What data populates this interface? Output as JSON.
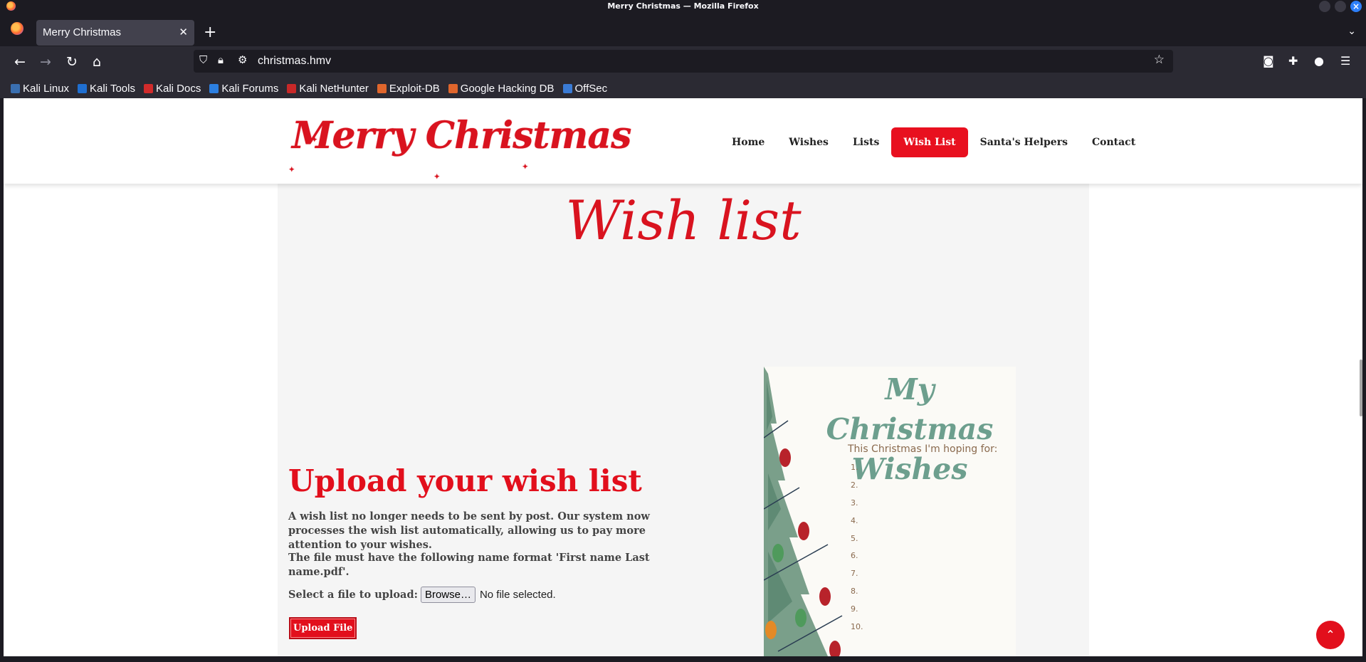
{
  "window": {
    "title": "Merry Christmas — Mozilla Firefox"
  },
  "tab": {
    "title": "Merry Christmas",
    "close": "✕",
    "new": "+"
  },
  "navbar": {
    "url": "christmas.hmv"
  },
  "bookmarks": [
    {
      "label": "Kali Linux",
      "color": "#3a6fb0"
    },
    {
      "label": "Kali Tools",
      "color": "#1f6fd1"
    },
    {
      "label": "Kali Docs",
      "color": "#d12b2b"
    },
    {
      "label": "Kali Forums",
      "color": "#2c7fe0"
    },
    {
      "label": "Kali NetHunter",
      "color": "#c82828"
    },
    {
      "label": "Exploit-DB",
      "color": "#e0662c"
    },
    {
      "label": "Google Hacking DB",
      "color": "#e0662c"
    },
    {
      "label": "OffSec",
      "color": "#3a7bd5"
    }
  ],
  "site": {
    "logo": "Merry Christmas",
    "menu": [
      "Home",
      "Wishes",
      "Lists",
      "Wish List",
      "Santa's Helpers",
      "Contact"
    ],
    "active_menu": "Wish List",
    "page_title": "Wish list",
    "upload_title": "Upload your wish list",
    "para1": "A wish list no longer needs to be sent by post. Our system now processes the wish list automatically, allowing us to pay more attention to your wishes.",
    "para2": "The file must have the following name format 'First name Last name.pdf'.",
    "file_label": "Select a file to upload:",
    "browse": "Browse…",
    "no_file": "No file selected.",
    "upload_button": "Upload File"
  },
  "card": {
    "title_line1": "My Christmas",
    "title_line2": "Wishes",
    "subtitle": "This Christmas I'm hoping for:",
    "items": [
      "1.",
      "2.",
      "3.",
      "4.",
      "5.",
      "6.",
      "7.",
      "8.",
      "9.",
      "10."
    ]
  },
  "colors": {
    "brand_red": "#e20f1c",
    "card_green": "#6d9f8e"
  }
}
